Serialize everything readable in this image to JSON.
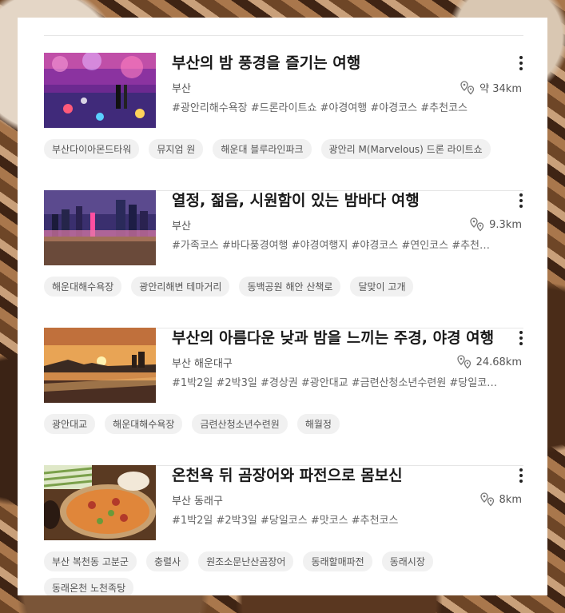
{
  "courses": [
    {
      "title": "부산의 밤 풍경을 즐기는 여행",
      "region": "부산",
      "distance": "약 34km",
      "hashtags": "#광안리해수욕장 #드론라이트쇼 #야경여행 #야경코스 #추천코스",
      "chips": [
        "부산다이아몬드타워",
        "뮤지엄 원",
        "해운대 블루라인파크",
        "광안리 M(Marvelous) 드론 라이트쇼"
      ]
    },
    {
      "title": "열정, 젊음, 시원함이 있는 밤바다 여행",
      "region": "부산",
      "distance": "9.3km",
      "hashtags": "#가족코스 #바다풍경여행 #야경여행지 #야경코스 #연인코스 #추천…",
      "chips": [
        "해운대해수욕장",
        "광안리해변 테마거리",
        "동백공원 해안 산책로",
        "달맞이 고개"
      ]
    },
    {
      "title": "부산의 아름다운 낮과 밤을 느끼는 주경, 야경 여행",
      "region": "부산 해운대구",
      "distance": "24.68km",
      "hashtags": "#1박2일 #2박3일 #경상권 #광안대교 #금련산청소년수련원 #당일코…",
      "chips": [
        "광안대교",
        "해운대해수욕장",
        "금련산청소년수련원",
        "해월정"
      ]
    },
    {
      "title": "온천욕 뒤 곰장어와 파전으로 몸보신",
      "region": "부산 동래구",
      "distance": "8km",
      "hashtags": "#1박2일 #2박3일 #당일코스 #맛코스 #추천코스",
      "chips": [
        "부산 복천동 고분군",
        "충렬사",
        "원조소문난산곰장어",
        "동래할매파전",
        "동래시장",
        "동래온천 노천족탕"
      ]
    }
  ],
  "icons": {
    "more": "more-vertical-icon",
    "distance": "map-pin-distance-icon"
  }
}
